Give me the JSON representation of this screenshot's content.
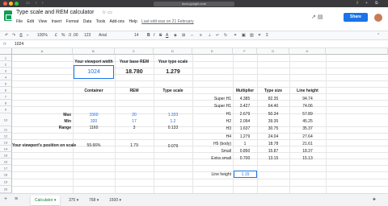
{
  "browser": {
    "url": "docs.google.com"
  },
  "doc": {
    "title": "Type scale and REM calculator",
    "menu": [
      "File",
      "Edit",
      "View",
      "Insert",
      "Format",
      "Data",
      "Tools",
      "Add-ons",
      "Help"
    ],
    "last_edit": "Last edit was on 21 February",
    "share_label": "Share"
  },
  "toolbar": {
    "zoom": "100%",
    "currency": "£",
    "percent": "%",
    "decimals": ".0  .00",
    "number_format": "123",
    "font": "Arial",
    "font_size": "14",
    "bold": "B",
    "italic": "I",
    "strike": "S",
    "text_color": "A"
  },
  "formula_bar": {
    "fx": "fx",
    "value": "1024"
  },
  "columns": [
    "A",
    "B",
    "C",
    "D",
    "E",
    "F",
    "G",
    "H"
  ],
  "rows": [
    "1",
    "2",
    "3",
    "4",
    "5",
    "6",
    "7",
    "8",
    "9",
    "10",
    "11",
    "12",
    "13",
    "14",
    "15",
    "16",
    "17",
    "18",
    "19",
    "20"
  ],
  "sheet": {
    "viewport_label": "Your viewport width",
    "base_rem_label": "Your base REM",
    "type_scale_label": "Your type scale",
    "viewport_value": "1024",
    "base_rem_value": "18.780",
    "type_scale_value": "1.279",
    "container_label": "Container",
    "rem_label": "REM",
    "typescale_col_label": "Type scale",
    "max_label": "Max",
    "min_label": "Min",
    "range_label": "Range",
    "max_container": "1560",
    "max_rem": "20",
    "max_scale": "1.333",
    "min_container": "320",
    "min_rem": "17",
    "min_scale": "1.2",
    "range_container": "1160",
    "range_rem": "3",
    "range_scale": "0.133",
    "position_label": "Your viewport's position on scale",
    "position_value": "59.66%",
    "position_rem": "1.79",
    "position_scale": "0.079",
    "multiplier_label": "Multiplier",
    "type_size_label": "Type size",
    "line_height_label": "Line height",
    "line_height_input_label": "Line height",
    "line_height_input_value": "1.15",
    "type_rows": [
      {
        "name": "Super H1",
        "mult": "4.385",
        "size": "82.35",
        "lh": "94.74"
      },
      {
        "name": "Super H1",
        "mult": "3.427",
        "size": "64.40",
        "lh": "74.06"
      },
      {
        "name": "H1",
        "mult": "2.679",
        "size": "50.34",
        "lh": "57.89"
      },
      {
        "name": "H2",
        "mult": "2.094",
        "size": "39.35",
        "lh": "45.25"
      },
      {
        "name": "H3",
        "mult": "1.637",
        "size": "30.75",
        "lh": "35.37"
      },
      {
        "name": "H4",
        "mult": "1.279",
        "size": "24.04",
        "lh": "27.64"
      },
      {
        "name": "H5 (body)",
        "mult": "1",
        "size": "18.78",
        "lh": "21.61"
      },
      {
        "name": "Small",
        "mult": "0.850",
        "size": "15.87",
        "lh": "18.37"
      },
      {
        "name": "Extra small",
        "mult": "0.700",
        "size": "13.15",
        "lh": "15.13"
      }
    ]
  },
  "tabs": {
    "add": "+",
    "list": "≡",
    "items": [
      "Calculator",
      "375",
      "768",
      "1500"
    ]
  },
  "colors": {
    "accent": "#1a73e8",
    "share": "#1a73e8",
    "sheets_green": "#0f9d58",
    "active_tab": "#188038"
  }
}
